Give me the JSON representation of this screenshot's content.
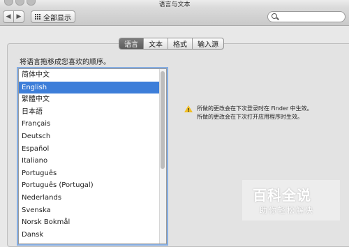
{
  "window": {
    "title": "语言与文本"
  },
  "toolbar": {
    "back_glyph": "◀",
    "forward_glyph": "▶",
    "show_all_label": "全部显示",
    "search_placeholder": ""
  },
  "tabs": [
    {
      "label": "语言",
      "active": true
    },
    {
      "label": "文本",
      "active": false
    },
    {
      "label": "格式",
      "active": false
    },
    {
      "label": "输入源",
      "active": false
    }
  ],
  "instruction": "将语言拖移成您喜欢的顺序。",
  "languages": [
    "简体中文",
    "English",
    "繁體中文",
    "日本語",
    "Français",
    "Deutsch",
    "Español",
    "Italiano",
    "Português",
    "Português (Portugal)",
    "Nederlands",
    "Svenska",
    "Norsk Bokmål",
    "Dansk"
  ],
  "selected_language_index": 1,
  "warning": {
    "line1": "所做的更改会在下次登录时在 Finder 中生效。",
    "line2": "所做的更改会在下次打开应用程序时生效。"
  },
  "watermark": {
    "main": "百科全说",
    "sub": "助你轻松解决"
  },
  "colors": {
    "selection": "#3d7ed9",
    "focus_ring": "#86aee3",
    "warning": "#f2c025"
  }
}
